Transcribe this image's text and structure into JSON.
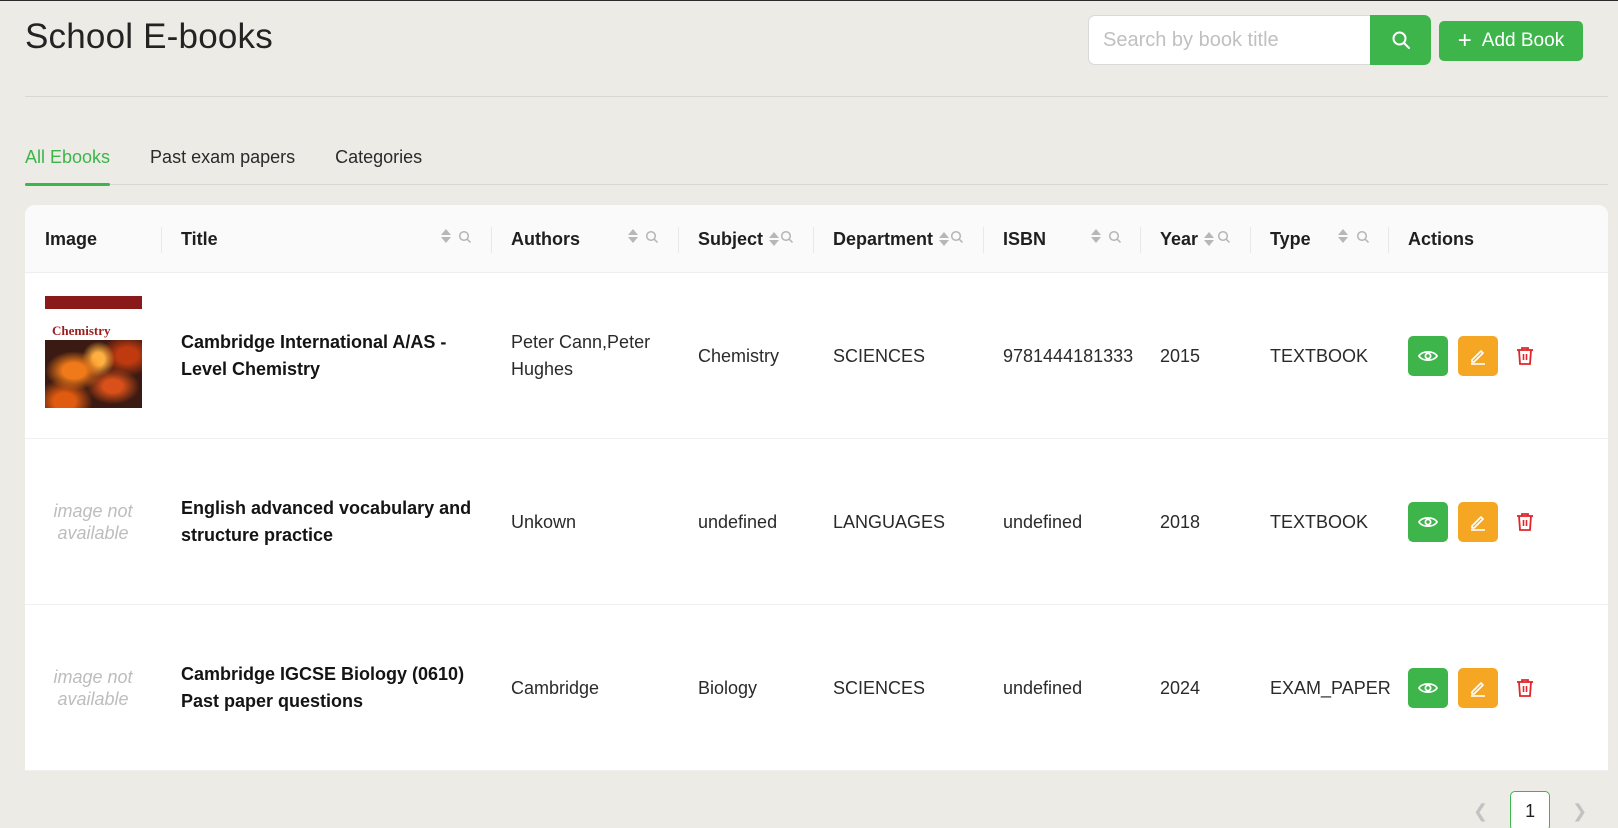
{
  "header": {
    "title": "School E-books",
    "search_placeholder": "Search by book title",
    "add_label": "Add Book"
  },
  "tabs": [
    {
      "label": "All Ebooks",
      "active": true
    },
    {
      "label": "Past exam papers",
      "active": false
    },
    {
      "label": "Categories",
      "active": false
    }
  ],
  "table": {
    "columns": [
      "Image",
      "Title",
      "Authors",
      "Subject",
      "Department",
      "ISBN",
      "Year",
      "Type",
      "Actions"
    ],
    "rows": [
      {
        "image": "cover",
        "cover_title": "Chemistry",
        "title": "Cambridge International A/AS - Level Chemistry",
        "authors": "Peter Cann,Peter Hughes",
        "subject": "Chemistry",
        "department": "SCIENCES",
        "isbn": "9781444181333",
        "year": "2015",
        "type": "TEXTBOOK"
      },
      {
        "image": "none",
        "no_image": "image not available",
        "title": "English advanced vocabulary and structure practice",
        "authors": "Unkown",
        "subject": "undefined",
        "department": "LANGUAGES",
        "isbn": "undefined",
        "year": "2018",
        "type": "TEXTBOOK"
      },
      {
        "image": "none",
        "no_image": "image not available",
        "title": "Cambridge IGCSE Biology (0610) Past paper questions",
        "authors": "Cambridge",
        "subject": "Biology",
        "department": "SCIENCES",
        "isbn": "undefined",
        "year": "2024",
        "type": "EXAM_PAPER"
      }
    ]
  },
  "pagination": {
    "current_page": "1",
    "prev_icon": "chevron-left-icon",
    "next_icon": "chevron-right-icon"
  },
  "colors": {
    "primary": "#3db54a",
    "edit": "#f5a623",
    "delete": "#e0262b",
    "background": "#ecebe6"
  },
  "icons": {
    "search": "search-icon",
    "add": "plus-icon",
    "view": "eye-icon",
    "edit": "pencil-icon",
    "delete": "trash-icon",
    "sort": "sort-icon"
  }
}
